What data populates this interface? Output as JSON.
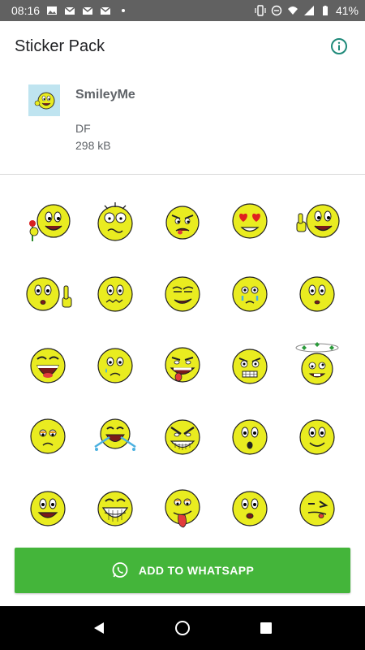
{
  "status_bar": {
    "time": "08:16",
    "battery": "41%",
    "left_icons": [
      "image-icon",
      "gmail-icon",
      "gmail-icon",
      "gmail-icon",
      "dot-icon"
    ],
    "right_icons": [
      "vibrate-icon",
      "dnd-icon",
      "wifi-icon",
      "signal-icon",
      "battery-icon"
    ]
  },
  "app_bar": {
    "title": "Sticker Pack",
    "info_icon": "info-icon"
  },
  "pack": {
    "name": "SmileyMe",
    "publisher": "DF",
    "size": "298 kB"
  },
  "stickers": [
    "smiley-with-rose",
    "smiley-scared",
    "smiley-angry-tongue",
    "smiley-heart-eyes",
    "smiley-thumbs-up",
    "smiley-pointing-up",
    "smiley-nervous",
    "smiley-smirk",
    "smiley-crying",
    "smiley-surprised",
    "smiley-laughing",
    "smiley-sad-tear",
    "smiley-crazy-tongue",
    "smiley-gritting-teeth",
    "smiley-dizzy",
    "smiley-sleepy-sad",
    "smiley-crying-laugh",
    "smiley-evil-grin",
    "smiley-shocked",
    "smiley-smile",
    "smiley-happy",
    "smiley-big-laugh",
    "smiley-drunk-tongue",
    "smiley-o-mouth",
    "smiley-winking-tongue"
  ],
  "add_button": {
    "label": "ADD TO WHATSAPP",
    "icon": "whatsapp-icon"
  },
  "colors": {
    "accent": "#44b53a",
    "info": "#1f8a7a",
    "smiley": "#e9ec20",
    "status_bar": "#616161"
  }
}
